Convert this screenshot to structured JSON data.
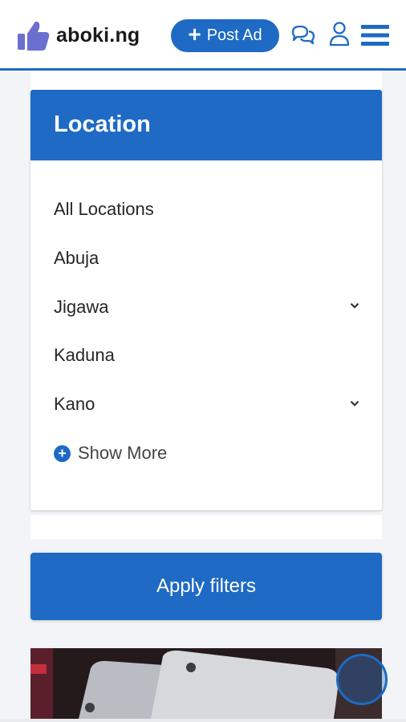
{
  "header": {
    "logo_text": "aboki.ng",
    "logo_icon": "thumbs-up-icon",
    "post_ad_label": "Post Ad",
    "post_ad_icon": "plus-icon",
    "icons": [
      "chat-icon",
      "user-icon",
      "menu-icon"
    ],
    "accent_color": "#1e6ac4"
  },
  "location_filter": {
    "title": "Location",
    "items": [
      {
        "label": "All Locations",
        "expandable": false
      },
      {
        "label": "Abuja",
        "expandable": false
      },
      {
        "label": "Jigawa",
        "expandable": true
      },
      {
        "label": "Kaduna",
        "expandable": false
      },
      {
        "label": "Kano",
        "expandable": true
      }
    ],
    "show_more_label": "Show More"
  },
  "apply_button_label": "Apply filters"
}
